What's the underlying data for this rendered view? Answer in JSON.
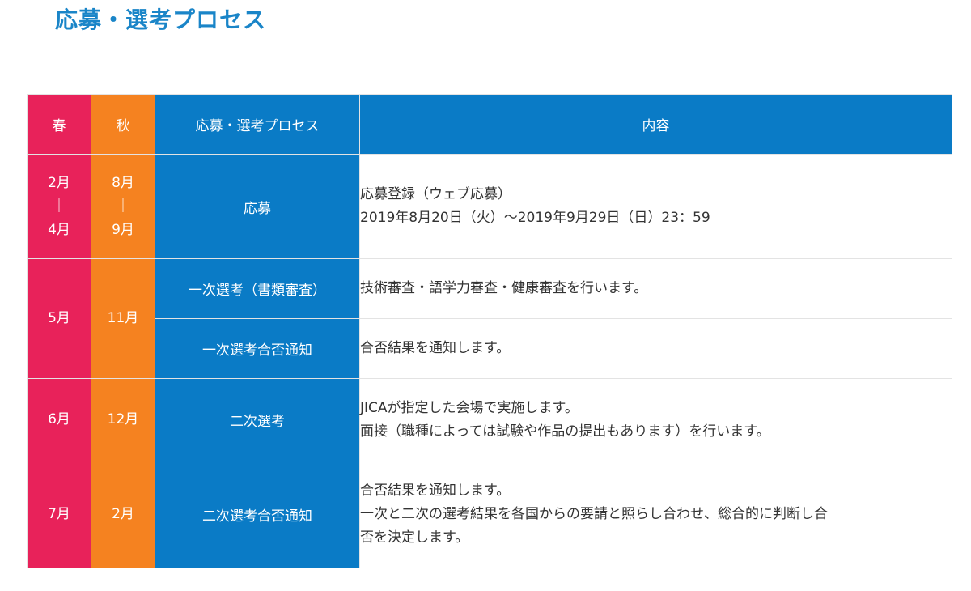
{
  "title": "応募・選考プロセス",
  "colors": {
    "title": "#1a85c8",
    "spring": "#e8225a",
    "autumn": "#f58220",
    "process": "#0a7bc6",
    "border": "#e3e3e3"
  },
  "headers": {
    "spring": "春",
    "autumn": "秋",
    "process": "応募・選考プロセス",
    "content": "内容"
  },
  "rows": [
    {
      "spring": [
        "2月",
        "｜",
        "4月"
      ],
      "autumn": [
        "8月",
        "｜",
        "9月"
      ],
      "process": "応募",
      "content": [
        "応募登録（ウェブ応募）",
        "2019年8月20日（火）～2019年9月29日（日）23：59"
      ]
    },
    {
      "spring": "5月",
      "autumn": "11月",
      "process": "一次選考（書類審査）",
      "content": [
        "技術審査・語学力審査・健康審査を行います。"
      ]
    },
    {
      "process": "一次選考合否通知",
      "content": [
        "合否結果を通知します。"
      ]
    },
    {
      "spring": "6月",
      "autumn": "12月",
      "process": "二次選考",
      "content": [
        "JICAが指定した会場で実施します。",
        "面接（職種によっては試験や作品の提出もあります）を行います。"
      ]
    },
    {
      "spring": "7月",
      "autumn": "2月",
      "process": "二次選考合否通知",
      "content": [
        "合否結果を通知します。",
        "一次と二次の選考結果を各国からの要請と照らし合わせ、総合的に判断し合",
        "否を決定します。"
      ]
    }
  ]
}
